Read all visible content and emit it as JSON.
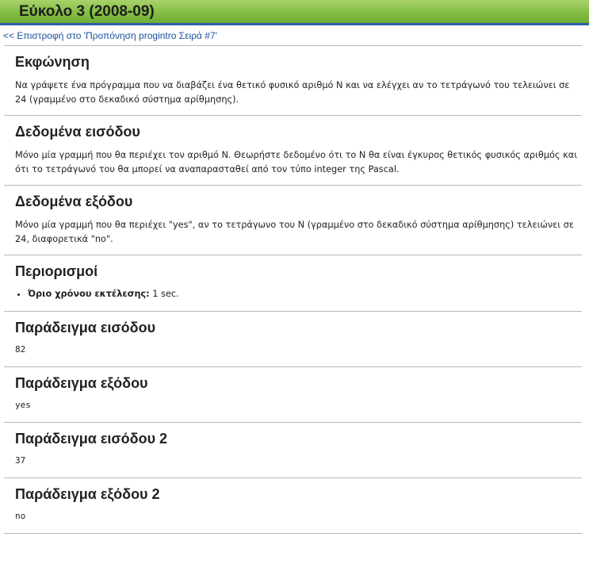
{
  "header": {
    "title": "Εύκολο 3 (2008-09)",
    "back_link": "<< Επιστροφή στο 'Προπόνηση progintro Σειρά #7'"
  },
  "sections": {
    "statement": {
      "heading": "Εκφώνηση",
      "text": "Να γράψετε ένα πρόγραμμα που να διαβάζει ένα θετικό φυσικό αριθμό Ν και να ελέγχει αν το τετράγωνό του τελειώνει σε 24 (γραμμένο στο δεκαδικό σύστημα αρίθμησης)."
    },
    "input": {
      "heading": "Δεδομένα εισόδου",
      "text": "Μόνο μία γραμμή που θα περιέχει τον αριθμό Ν. Θεωρήστε δεδομένο ότι το Ν θα είναι έγκυρος θετικός φυσικός αριθμός και ότι το τετράγωνό του θα μπορεί να αναπαρασταθεί από τον τύπο integer της Pascal."
    },
    "output": {
      "heading": "Δεδομένα εξόδου",
      "text": "Μόνο μία γραμμή που θα περιέχει \"yes\", αν το τετράγωνο του Ν (γραμμένο στο δεκαδικό σύστημα αρίθμησης) τελειώνει σε 24, διαφορετικά \"no\"."
    },
    "constraints": {
      "heading": "Περιορισμοί",
      "time_label": "Όριο χρόνου εκτέλεσης:",
      "time_value": " 1 sec."
    },
    "sample_input_1": {
      "heading": "Παράδειγμα εισόδου",
      "code": "82"
    },
    "sample_output_1": {
      "heading": "Παράδειγμα εξόδου",
      "code": "yes"
    },
    "sample_input_2": {
      "heading": "Παράδειγμα εισόδου 2",
      "code": "37"
    },
    "sample_output_2": {
      "heading": "Παράδειγμα εξόδου 2",
      "code": "no"
    }
  },
  "colors": {
    "title_bar_green": "#86bf46",
    "title_bar_border": "#2f5fa8",
    "link": "#1a4fa0"
  }
}
